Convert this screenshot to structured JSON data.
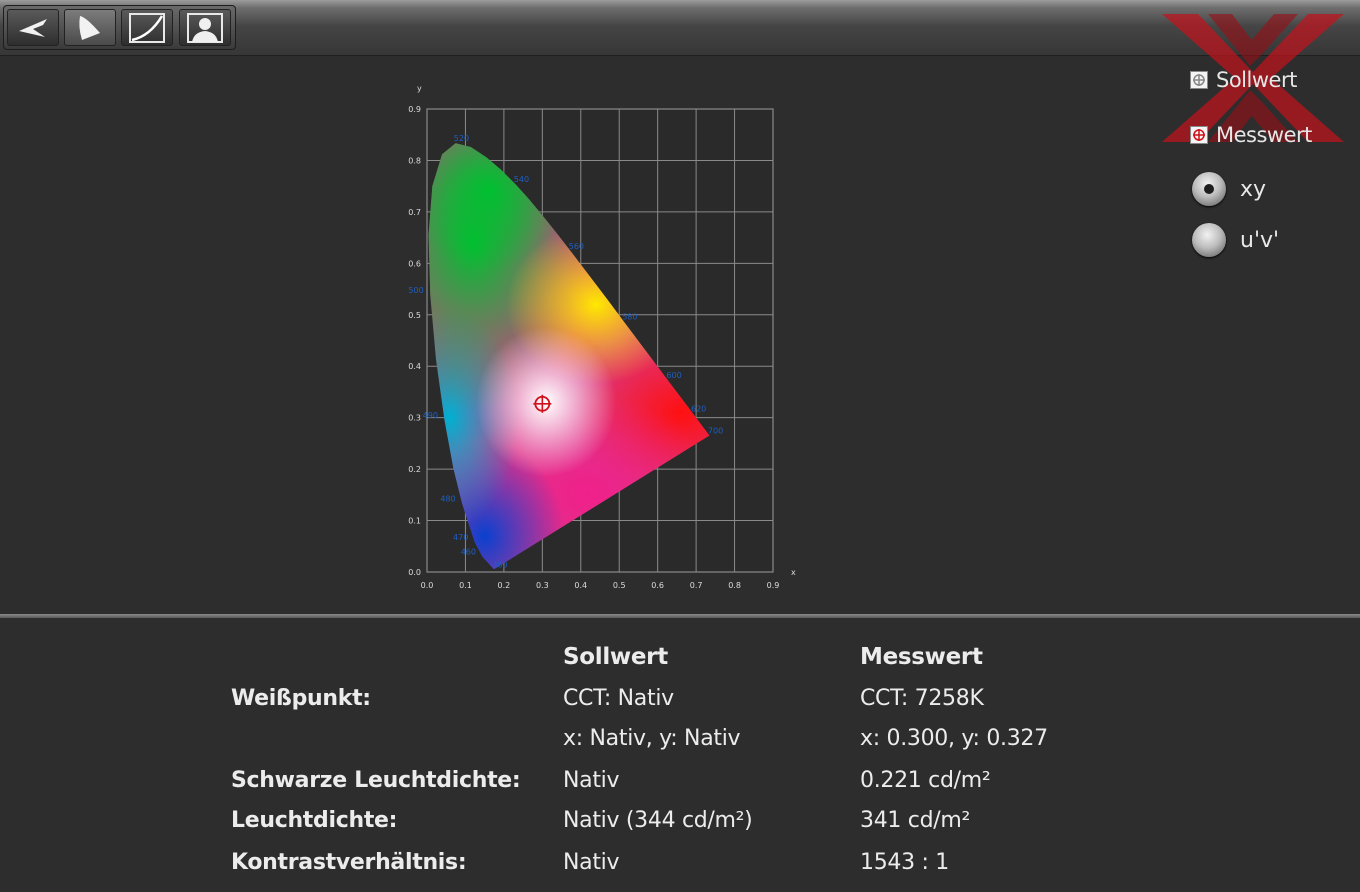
{
  "toolbar": {
    "buttons": [
      {
        "icon": "gamut-fan-icon",
        "active": false
      },
      {
        "icon": "gamut-triangle-icon",
        "active": true
      },
      {
        "icon": "gamma-curve-icon",
        "active": false
      },
      {
        "icon": "portrait-icon",
        "active": false
      }
    ]
  },
  "legend": {
    "target_label": "Sollwert",
    "measured_label": "Messwert"
  },
  "color_space": {
    "options": [
      {
        "label": "xy",
        "selected": true
      },
      {
        "label": "u'v'",
        "selected": false
      }
    ]
  },
  "chart_data": {
    "type": "scatter",
    "title": "",
    "xlabel": "x",
    "ylabel": "y",
    "xlim": [
      0,
      0.9
    ],
    "ylim": [
      0,
      0.9
    ],
    "grid": true,
    "x_ticks": [
      "0.0",
      "0.1",
      "0.2",
      "0.3",
      "0.4",
      "0.5",
      "0.6",
      "0.7",
      "0.8",
      "0.9"
    ],
    "y_ticks": [
      "0.0",
      "0.1",
      "0.2",
      "0.3",
      "0.4",
      "0.5",
      "0.6",
      "0.7",
      "0.8",
      "0.9"
    ],
    "wavelength_labels": [
      {
        "nm": "520",
        "x": 0.074,
        "y": 0.834
      },
      {
        "nm": "540",
        "x": 0.23,
        "y": 0.754
      },
      {
        "nm": "560",
        "x": 0.373,
        "y": 0.624
      },
      {
        "nm": "580",
        "x": 0.512,
        "y": 0.487
      },
      {
        "nm": "600",
        "x": 0.627,
        "y": 0.373
      },
      {
        "nm": "620",
        "x": 0.691,
        "y": 0.308
      },
      {
        "nm": "700",
        "x": 0.735,
        "y": 0.265
      },
      {
        "nm": "500",
        "x": 0.008,
        "y": 0.538
      },
      {
        "nm": "490",
        "x": 0.045,
        "y": 0.295
      },
      {
        "nm": "480",
        "x": 0.091,
        "y": 0.133
      },
      {
        "nm": "470",
        "x": 0.124,
        "y": 0.058
      },
      {
        "nm": "460",
        "x": 0.144,
        "y": 0.03
      },
      {
        "nm": "380",
        "x": 0.174,
        "y": 0.005
      }
    ],
    "series": [
      {
        "name": "Messwert",
        "points": [
          {
            "x": 0.3,
            "y": 0.327
          }
        ]
      }
    ]
  },
  "info": {
    "col_target": "Sollwert",
    "col_measured": "Messwert",
    "rows": [
      {
        "label": "Weißpunkt:",
        "target": "CCT: Nativ",
        "measured": "CCT: 7258K"
      },
      {
        "label": "",
        "target": "x: Nativ, y: Nativ",
        "measured": "x: 0.300, y: 0.327"
      },
      {
        "label": "Schwarze Leuchtdichte:",
        "target": "Nativ",
        "measured": "0.221 cd/m²"
      },
      {
        "label": "Leuchtdichte:",
        "target": "Nativ (344 cd/m²)",
        "measured": "341 cd/m²"
      },
      {
        "label": "Kontrastverhältnis:",
        "target": "Nativ",
        "measured": "1543 : 1"
      }
    ]
  }
}
